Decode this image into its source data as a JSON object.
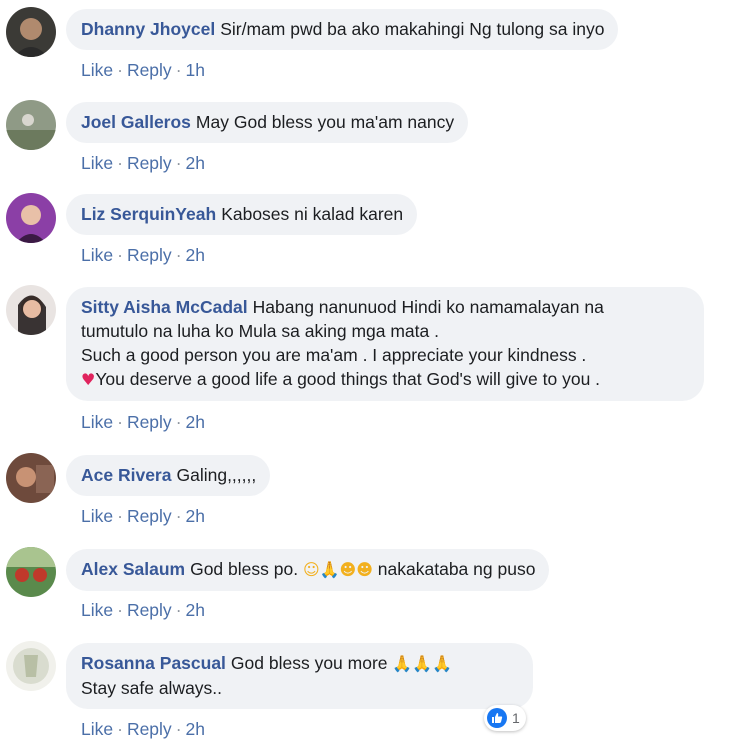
{
  "actions": {
    "like": "Like",
    "reply": "Reply",
    "sep": "·"
  },
  "comments": [
    {
      "author": "Dhanny Jhoycel",
      "text": "Sir/mam pwd ba ako makahingi Ng tulong sa inyo",
      "time": "1h"
    },
    {
      "author": "Joel Galleros",
      "text": "May God bless you ma'am nancy",
      "time": "2h"
    },
    {
      "author": "Liz SerquinYeah",
      "text": "Kaboses ni kalad karen",
      "time": "2h"
    },
    {
      "author": "Sitty Aisha McCadal",
      "line1": "Habang nanunuod Hindi ko namamalayan na",
      "line2": "tumutulo na luha ko Mula sa aking mga mata .",
      "line3": "Such a good person you are ma'am . I appreciate your kindness .",
      "line4": "You deserve a good life a good things that God's will give to you .",
      "time": "2h"
    },
    {
      "author": "Ace Rivera",
      "text": "Galing,,,,,,",
      "time": "2h"
    },
    {
      "author": "Alex Salaum",
      "text_a": "God bless po.",
      "text_b": "nakakataba ng puso",
      "time": "2h"
    },
    {
      "author": "Rosanna Pascual",
      "text": "God bless you more",
      "line2": "Stay safe always..",
      "time": "2h",
      "reaction_count": "1"
    }
  ],
  "emoji": {
    "pray": "🙏",
    "blush": "☺",
    "kiss": "☻",
    "heart": "♥"
  },
  "colors": {
    "author": "#385898",
    "bubble": "#f0f2f5",
    "link": "#4b6fa8",
    "like_blue": "#1877f2"
  },
  "icons": {
    "reaction": "like-thumb-icon"
  }
}
